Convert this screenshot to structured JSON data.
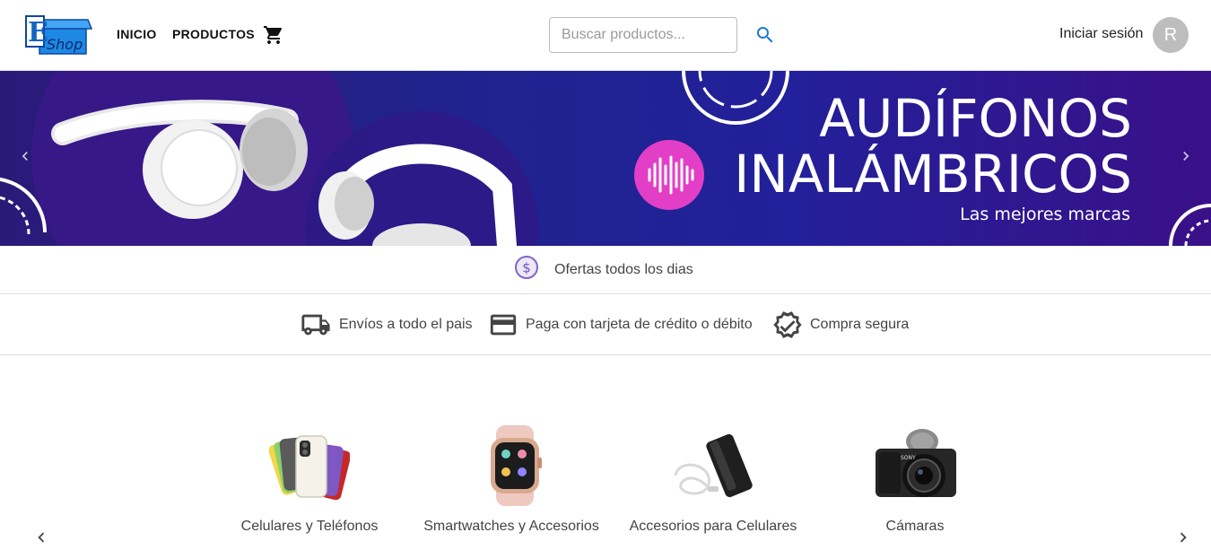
{
  "header": {
    "nav_inicio": "INICIO",
    "nav_productos": "PRODUCTOS",
    "search_placeholder": "Buscar productos...",
    "login_label": "Iniciar sesión",
    "avatar_initial": "R",
    "logo_text": "Shop"
  },
  "banner": {
    "title_line1": "AUDÍFONOS",
    "title_line2": "INALÁMBRICOS",
    "subtitle": "Las mejores marcas"
  },
  "offers": {
    "text": "Ofertas todos los dias"
  },
  "features": [
    {
      "label": "Envíos a todo el pais",
      "icon": "truck-icon"
    },
    {
      "label": "Paga con tarjeta de crédito o débito",
      "icon": "credit-card-icon"
    },
    {
      "label": "Compra segura",
      "icon": "verified-badge-icon"
    }
  ],
  "categories": [
    {
      "label": "Celulares y Teléfonos",
      "icon": "phones-image"
    },
    {
      "label": "Smartwatches y Accesorios",
      "icon": "smartwatch-image"
    },
    {
      "label": "Accesorios para Celulares",
      "icon": "powerbank-image"
    },
    {
      "label": "Cámaras",
      "icon": "camera-image"
    }
  ],
  "colors": {
    "accent_blue": "#1976d2",
    "banner_bg": "#22209a",
    "banner_pink": "#e23fc6",
    "offers_icon": "#7b68c8"
  }
}
